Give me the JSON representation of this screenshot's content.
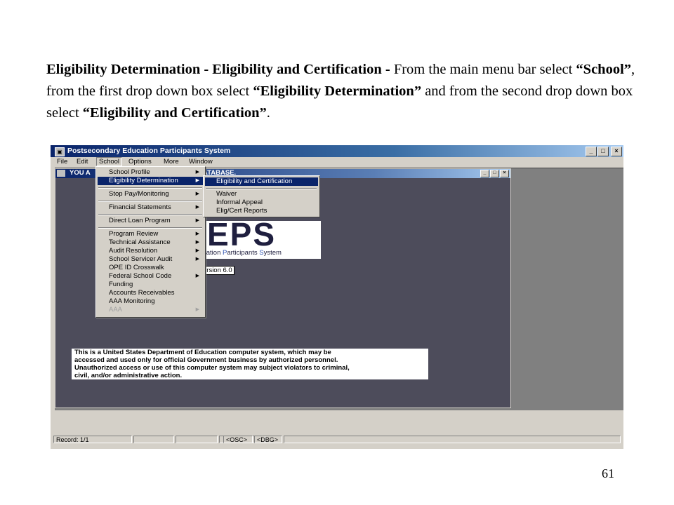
{
  "caption": {
    "part1_bold": "Eligibility Determination - Eligibility and Certification -",
    "part2": " From the main menu bar select ",
    "part3_bold": "“School”",
    "part4": ", from the first drop down box select ",
    "part5_bold": "“Eligibility Determination”",
    "part6": " and from the second drop down box select ",
    "part7_bold": "“Eligibility and Certification”",
    "part8": "."
  },
  "page_number": "61",
  "app": {
    "title": "Postsecondary Education Participants System",
    "menubar": [
      "File",
      "Edit",
      "School",
      "Options",
      "More",
      "Window"
    ],
    "active_menu": "School",
    "child_title_left": "YOU A",
    "child_title_right": "ATABASE.",
    "logo_text": "EPS",
    "logo_subtitle_parts": [
      "cation ",
      "P",
      "articipants ",
      "S",
      "ystem"
    ],
    "version": "ersion 6.0",
    "notice": [
      "This is a United States Department of Education computer system, which may be",
      "accessed and used only for official Government business by authorized personnel.",
      "Unauthorized access or use of this computer system may subject violators to criminal,",
      "civil, and/or administrative action."
    ],
    "status": [
      "Record: 1/1",
      "",
      "",
      "",
      "<OSC>",
      "<DBG>",
      ""
    ],
    "window_buttons": {
      "min": "_",
      "max": "□",
      "close": "×"
    }
  },
  "school_menu": [
    {
      "label": "School Profile",
      "submenu": true
    },
    {
      "label": "Eligibility Determination",
      "submenu": true,
      "selected": true
    },
    {
      "separator": true
    },
    {
      "label": "Stop Pay/Monitoring",
      "submenu": true
    },
    {
      "separator": true
    },
    {
      "label": "Financial Statements",
      "submenu": true
    },
    {
      "separator": true
    },
    {
      "label": "Direct Loan Program",
      "submenu": true
    },
    {
      "separator": true
    },
    {
      "label": "Program Review",
      "submenu": true
    },
    {
      "label": "Technical Assistance",
      "submenu": true
    },
    {
      "label": "Audit Resolution",
      "submenu": true
    },
    {
      "label": "School Servicer Audit",
      "submenu": true
    },
    {
      "label": "OPE ID Crosswalk",
      "submenu": false
    },
    {
      "label": "Federal School Code",
      "submenu": true
    },
    {
      "label": "Funding",
      "submenu": false
    },
    {
      "label": "Accounts Receivables",
      "submenu": false
    },
    {
      "label": "AAA Monitoring",
      "submenu": false
    },
    {
      "label": "AAA",
      "submenu": true,
      "disabled": true
    }
  ],
  "eligibility_submenu": [
    {
      "label": "Eligibility and Certification",
      "selected": true
    },
    {
      "separator": true
    },
    {
      "label": "Waiver"
    },
    {
      "label": "Informal Appeal"
    },
    {
      "label": "Elig/Cert Reports"
    }
  ],
  "colors": {
    "desktop": "#4d4c5b",
    "menu_highlight": "#0a246a",
    "window_chrome": "#d4d0c8"
  }
}
